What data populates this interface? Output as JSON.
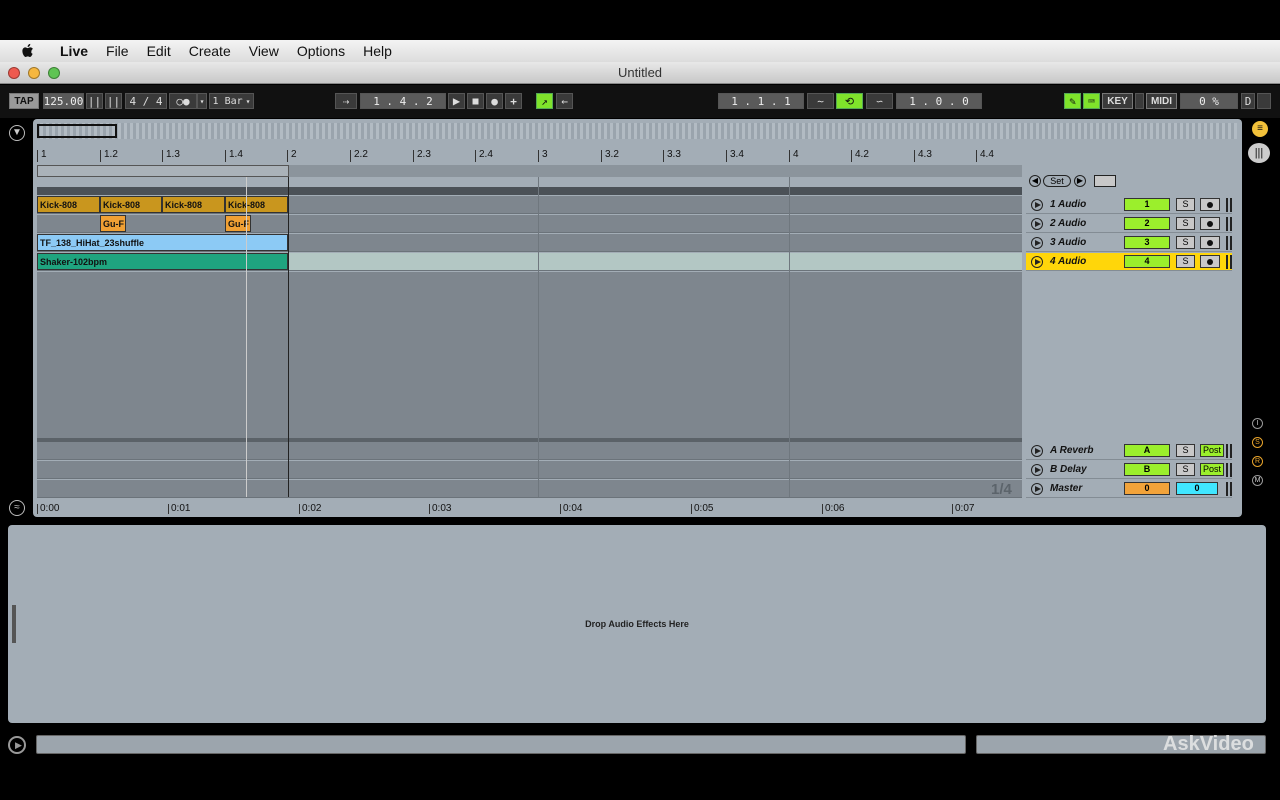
{
  "menubar": {
    "items": [
      "Live",
      "File",
      "Edit",
      "Create",
      "View",
      "Options",
      "Help"
    ]
  },
  "window": {
    "title": "Untitled"
  },
  "control_bar": {
    "tap": "TAP",
    "tempo": "125.00",
    "time_sig": "4 / 4",
    "quantize": "1 Bar",
    "position": "1 .  4 .  2",
    "loop_start": "1 .  1 .  1",
    "loop_length": "1 .  0 .  0",
    "key": "KEY",
    "midi": "MIDI",
    "cpu": "0 %",
    "d": "D"
  },
  "ruler": {
    "beats": [
      "1",
      "1.2",
      "1.3",
      "1.4",
      "2",
      "2.2",
      "2.3",
      "2.4",
      "3",
      "3.2",
      "3.3",
      "3.4",
      "4",
      "4.2",
      "4.3",
      "4.4"
    ],
    "times": [
      "0:00",
      "0:01",
      "0:02",
      "0:03",
      "0:04",
      "0:05",
      "0:06",
      "0:07"
    ]
  },
  "set_label": "Set",
  "grid_label": "1/4",
  "clips": {
    "kick": [
      "Kick-808",
      "Kick-808",
      "Kick-808",
      "Kick-808"
    ],
    "gu": [
      "Gu-F",
      "Gu-F"
    ],
    "hihat": "TF_138_HiHat_23shuffle",
    "shaker": "Shaker-102bpm"
  },
  "tracks": [
    {
      "name": "1 Audio",
      "num": "1",
      "solo": "S"
    },
    {
      "name": "2 Audio",
      "num": "2",
      "solo": "S"
    },
    {
      "name": "3 Audio",
      "num": "3",
      "solo": "S"
    },
    {
      "name": "4 Audio",
      "num": "4",
      "solo": "S"
    }
  ],
  "returns": [
    {
      "name": "A Reverb",
      "num": "A",
      "solo": "S",
      "post": "Post"
    },
    {
      "name": "B Delay",
      "num": "B",
      "solo": "S",
      "post": "Post"
    }
  ],
  "master": {
    "name": "Master",
    "vol": "0",
    "pan": "0"
  },
  "detail": {
    "drop_hint": "Drop Audio Effects Here"
  },
  "watermark": "AskVideo",
  "colors": {
    "accent_green": "#9bef2c",
    "selected_track": "#ffd60a",
    "kick_clip": "#c9961e",
    "hihat_clip": "#8ccaf5",
    "shaker_clip": "#1fa47f"
  }
}
